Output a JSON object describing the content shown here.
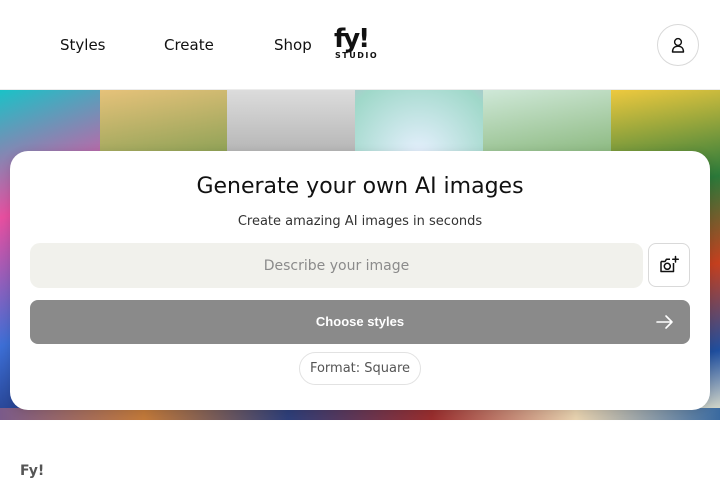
{
  "header": {
    "nav": [
      {
        "label": "Styles"
      },
      {
        "label": "Create"
      },
      {
        "label": "Shop"
      }
    ],
    "logo": {
      "mark": "fy!",
      "sub": "STUDIO"
    },
    "account_icon": "user-icon"
  },
  "hero": {
    "tiles": [
      {
        "color": "#1c9fa8"
      },
      {
        "color": "#9c8a5a"
      },
      {
        "color": "#5b3d6b"
      },
      {
        "color": "#6f6f6f"
      },
      {
        "color": "#9ec6c7"
      },
      {
        "color": "#4e8a4a"
      },
      {
        "color": "#2c6b5a"
      },
      {
        "color": "#2a3f8a"
      }
    ]
  },
  "generator": {
    "title": "Generate your own AI images",
    "subtitle": "Create amazing AI images in seconds",
    "prompt_placeholder": "Describe your image",
    "prompt_value": "",
    "upload_icon": "camera-plus-icon",
    "choose_label": "Choose styles",
    "choose_icon": "arrow-right-icon",
    "format_label": "Format: Square"
  },
  "footer": {
    "brand": "Fy!"
  },
  "colors": {
    "button_disabled": "#8a8a8a",
    "input_bg": "#f1f1ec",
    "text": "#111111"
  }
}
